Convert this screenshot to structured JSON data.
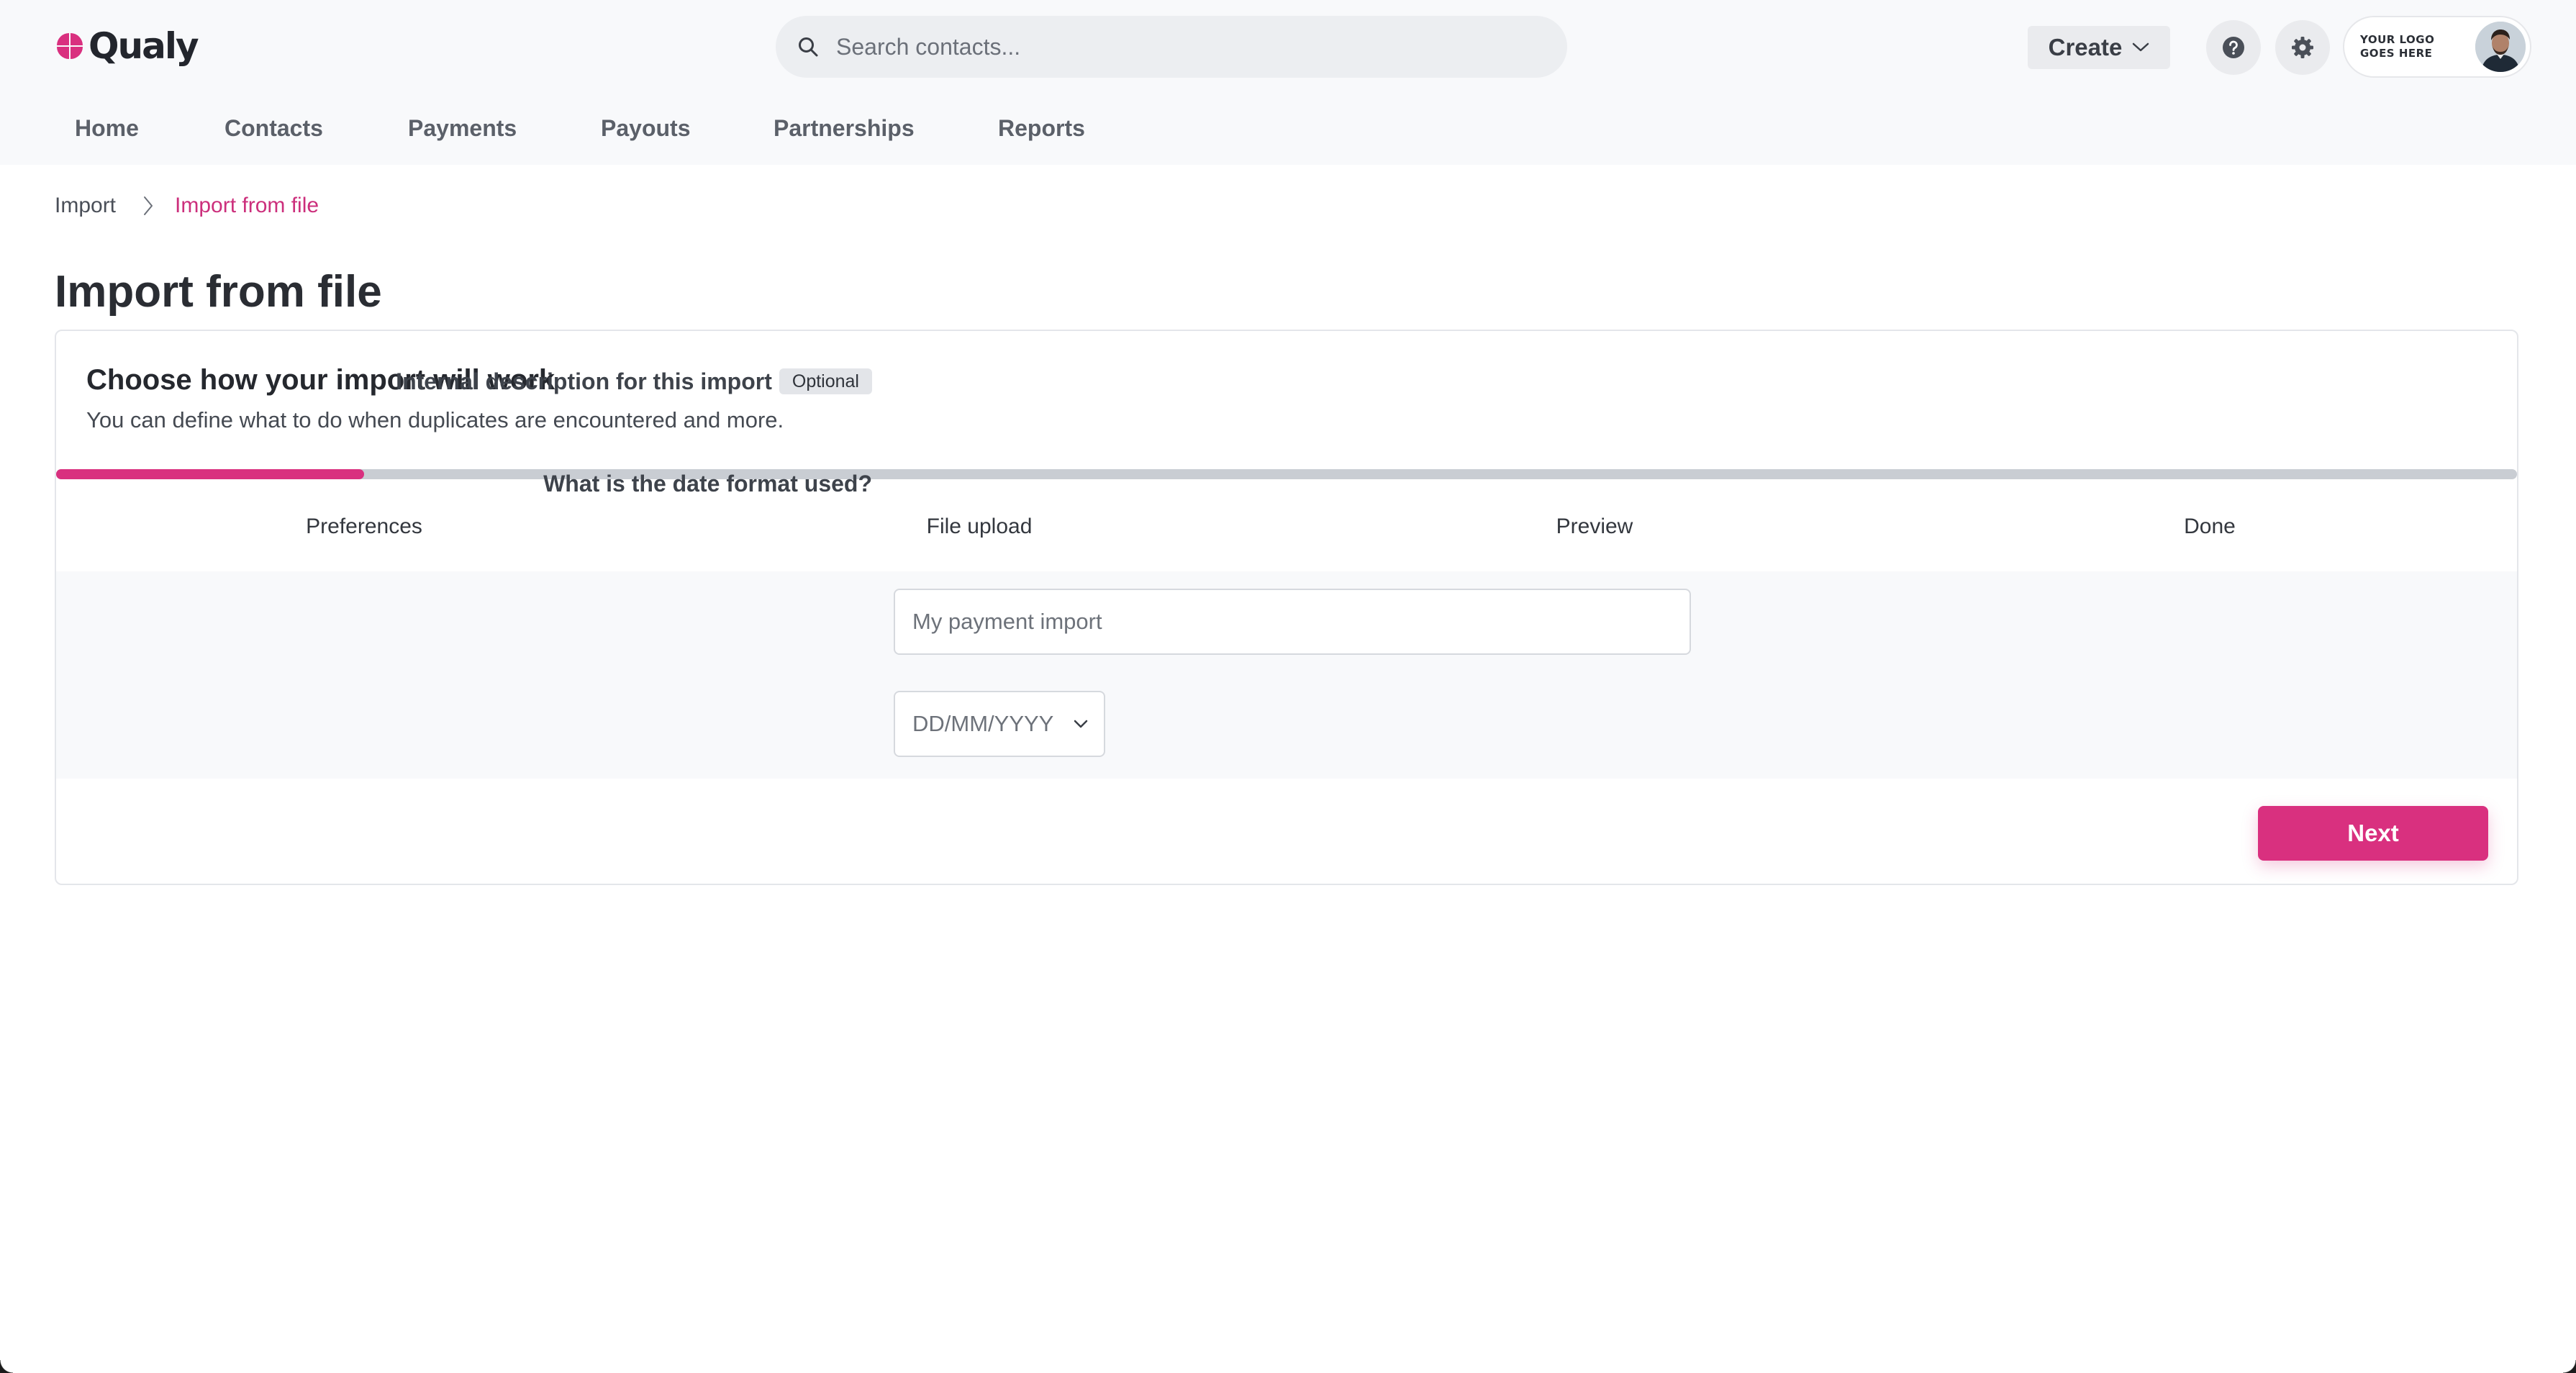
{
  "header": {
    "logo_text": "Qualy",
    "search_placeholder": "Search contacts...",
    "create_label": "Create",
    "brand_logo_line1": "YOUR LOGO",
    "brand_logo_line2": "GOES HERE"
  },
  "nav": {
    "items": [
      "Home",
      "Contacts",
      "Payments",
      "Payouts",
      "Partnerships",
      "Reports"
    ]
  },
  "breadcrumb": {
    "parent": "Import",
    "current": "Import from file"
  },
  "page": {
    "title": "Import from file"
  },
  "card": {
    "title": "Choose how your import will work",
    "subtitle": "You can define what to do when duplicates are encountered and more.",
    "progress_fraction": 0.125,
    "steps": [
      "Preferences",
      "File upload",
      "Preview",
      "Done"
    ],
    "active_step": 0
  },
  "form": {
    "description_label": "Internal description for this import",
    "optional_badge": "Optional",
    "description_placeholder": "My payment import",
    "date_format_label": "What is the date format used?",
    "date_format_value": "DD/MM/YYYY"
  },
  "actions": {
    "next_label": "Next"
  },
  "colors": {
    "accent": "#d9307f",
    "accent_text": "#cc2f7c",
    "header_bg": "#f8f9fb",
    "track": "#c9cdd3"
  }
}
